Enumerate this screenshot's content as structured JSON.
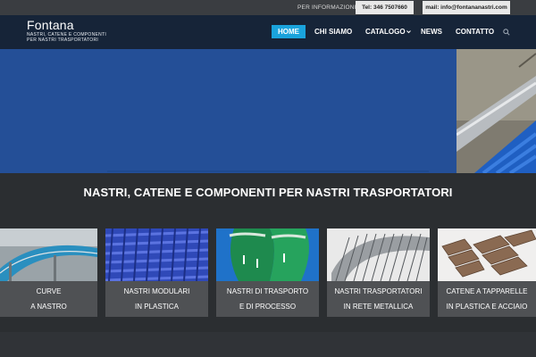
{
  "topbar": {
    "info_label": "PER INFORMAZIONI:",
    "phone": "Tel: 346 7507660",
    "email": "mail: info@fontananastri.com"
  },
  "logo": {
    "name": "Fontana",
    "tagline_1": "NASTRI, CATENE E COMPONENTI",
    "tagline_2": "PER NASTRI TRASPORTATORI"
  },
  "nav": {
    "items": [
      {
        "label": "HOME"
      },
      {
        "label": "CHI SIAMO"
      },
      {
        "label": "CATALOGO"
      },
      {
        "label": "NEWS"
      },
      {
        "label": "CONTATTO"
      }
    ],
    "active_color": "#1aa3dc"
  },
  "main": {
    "heading": "NASTRI, CATENE E COMPONENTI PER NASTRI TRASPORTATORI"
  },
  "categories": [
    {
      "line1": "CURVE",
      "line2": "A NASTRO"
    },
    {
      "line1": "NASTRI MODULARI",
      "line2": "IN PLASTICA"
    },
    {
      "line1": "NASTRI DI TRASPORTO",
      "line2": "E DI PROCESSO"
    },
    {
      "line1": "NASTRI TRASPORTATORI",
      "line2": "IN RETE METALLICA"
    },
    {
      "line1": "CATENE A TAPPARELLE",
      "line2": "IN PLASTICA E ACCIAIO"
    }
  ],
  "colors": {
    "navbar": "#162438",
    "hero": "#244f97",
    "page_bg": "#2b2e31",
    "caption_bg": "#4f5154"
  }
}
